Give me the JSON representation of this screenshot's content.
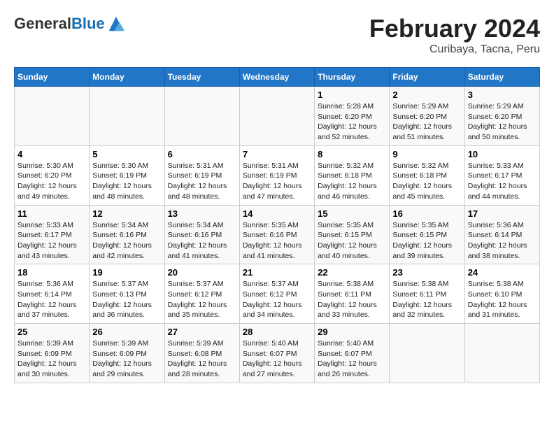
{
  "header": {
    "logo_general": "General",
    "logo_blue": "Blue",
    "title": "February 2024",
    "subtitle": "Curibaya, Tacna, Peru"
  },
  "columns": [
    "Sunday",
    "Monday",
    "Tuesday",
    "Wednesday",
    "Thursday",
    "Friday",
    "Saturday"
  ],
  "weeks": [
    [
      {
        "day": "",
        "info": ""
      },
      {
        "day": "",
        "info": ""
      },
      {
        "day": "",
        "info": ""
      },
      {
        "day": "",
        "info": ""
      },
      {
        "day": "1",
        "info": "Sunrise: 5:28 AM\nSunset: 6:20 PM\nDaylight: 12 hours and 52 minutes."
      },
      {
        "day": "2",
        "info": "Sunrise: 5:29 AM\nSunset: 6:20 PM\nDaylight: 12 hours and 51 minutes."
      },
      {
        "day": "3",
        "info": "Sunrise: 5:29 AM\nSunset: 6:20 PM\nDaylight: 12 hours and 50 minutes."
      }
    ],
    [
      {
        "day": "4",
        "info": "Sunrise: 5:30 AM\nSunset: 6:20 PM\nDaylight: 12 hours and 49 minutes."
      },
      {
        "day": "5",
        "info": "Sunrise: 5:30 AM\nSunset: 6:19 PM\nDaylight: 12 hours and 48 minutes."
      },
      {
        "day": "6",
        "info": "Sunrise: 5:31 AM\nSunset: 6:19 PM\nDaylight: 12 hours and 48 minutes."
      },
      {
        "day": "7",
        "info": "Sunrise: 5:31 AM\nSunset: 6:19 PM\nDaylight: 12 hours and 47 minutes."
      },
      {
        "day": "8",
        "info": "Sunrise: 5:32 AM\nSunset: 6:18 PM\nDaylight: 12 hours and 46 minutes."
      },
      {
        "day": "9",
        "info": "Sunrise: 5:32 AM\nSunset: 6:18 PM\nDaylight: 12 hours and 45 minutes."
      },
      {
        "day": "10",
        "info": "Sunrise: 5:33 AM\nSunset: 6:17 PM\nDaylight: 12 hours and 44 minutes."
      }
    ],
    [
      {
        "day": "11",
        "info": "Sunrise: 5:33 AM\nSunset: 6:17 PM\nDaylight: 12 hours and 43 minutes."
      },
      {
        "day": "12",
        "info": "Sunrise: 5:34 AM\nSunset: 6:16 PM\nDaylight: 12 hours and 42 minutes."
      },
      {
        "day": "13",
        "info": "Sunrise: 5:34 AM\nSunset: 6:16 PM\nDaylight: 12 hours and 41 minutes."
      },
      {
        "day": "14",
        "info": "Sunrise: 5:35 AM\nSunset: 6:16 PM\nDaylight: 12 hours and 41 minutes."
      },
      {
        "day": "15",
        "info": "Sunrise: 5:35 AM\nSunset: 6:15 PM\nDaylight: 12 hours and 40 minutes."
      },
      {
        "day": "16",
        "info": "Sunrise: 5:35 AM\nSunset: 6:15 PM\nDaylight: 12 hours and 39 minutes."
      },
      {
        "day": "17",
        "info": "Sunrise: 5:36 AM\nSunset: 6:14 PM\nDaylight: 12 hours and 38 minutes."
      }
    ],
    [
      {
        "day": "18",
        "info": "Sunrise: 5:36 AM\nSunset: 6:14 PM\nDaylight: 12 hours and 37 minutes."
      },
      {
        "day": "19",
        "info": "Sunrise: 5:37 AM\nSunset: 6:13 PM\nDaylight: 12 hours and 36 minutes."
      },
      {
        "day": "20",
        "info": "Sunrise: 5:37 AM\nSunset: 6:12 PM\nDaylight: 12 hours and 35 minutes."
      },
      {
        "day": "21",
        "info": "Sunrise: 5:37 AM\nSunset: 6:12 PM\nDaylight: 12 hours and 34 minutes."
      },
      {
        "day": "22",
        "info": "Sunrise: 5:38 AM\nSunset: 6:11 PM\nDaylight: 12 hours and 33 minutes."
      },
      {
        "day": "23",
        "info": "Sunrise: 5:38 AM\nSunset: 6:11 PM\nDaylight: 12 hours and 32 minutes."
      },
      {
        "day": "24",
        "info": "Sunrise: 5:38 AM\nSunset: 6:10 PM\nDaylight: 12 hours and 31 minutes."
      }
    ],
    [
      {
        "day": "25",
        "info": "Sunrise: 5:39 AM\nSunset: 6:09 PM\nDaylight: 12 hours and 30 minutes."
      },
      {
        "day": "26",
        "info": "Sunrise: 5:39 AM\nSunset: 6:09 PM\nDaylight: 12 hours and 29 minutes."
      },
      {
        "day": "27",
        "info": "Sunrise: 5:39 AM\nSunset: 6:08 PM\nDaylight: 12 hours and 28 minutes."
      },
      {
        "day": "28",
        "info": "Sunrise: 5:40 AM\nSunset: 6:07 PM\nDaylight: 12 hours and 27 minutes."
      },
      {
        "day": "29",
        "info": "Sunrise: 5:40 AM\nSunset: 6:07 PM\nDaylight: 12 hours and 26 minutes."
      },
      {
        "day": "",
        "info": ""
      },
      {
        "day": "",
        "info": ""
      }
    ]
  ]
}
